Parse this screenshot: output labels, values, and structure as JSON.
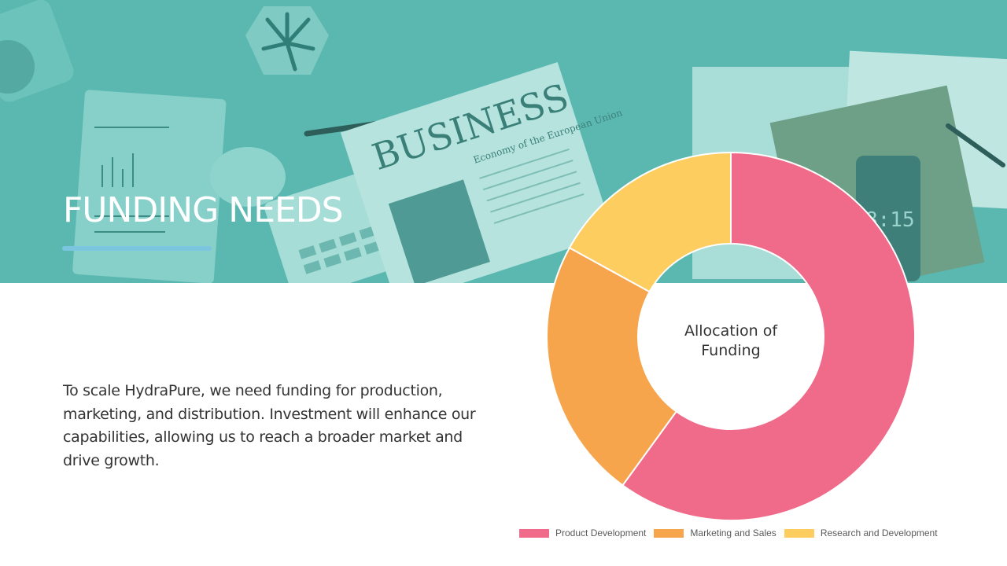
{
  "slide": {
    "title": "FUNDING NEEDS",
    "body": "To scale HydraPure, we need funding for production, marketing, and distribution. Investment will enhance our capabilities, allowing us to reach a broader market and drive growth."
  },
  "hero": {
    "newspaper_headline": "BUSINESS",
    "newspaper_subheadline": "Economy of the European Union",
    "phone_time": "8:15"
  },
  "colors": {
    "hero_tint": "#5bb8b1",
    "accent_line": "#7cc5df"
  },
  "chart_data": {
    "type": "pie",
    "subtype": "doughnut",
    "center_label": [
      "Allocation of",
      "Funding"
    ],
    "legend_position": "bottom",
    "series": [
      {
        "label": "Product Development",
        "value": 60,
        "color": "#f06a8a"
      },
      {
        "label": "Marketing and Sales",
        "value": 23,
        "color": "#f6a54c"
      },
      {
        "label": "Research and Development",
        "value": 17,
        "color": "#fdcd60"
      }
    ]
  }
}
